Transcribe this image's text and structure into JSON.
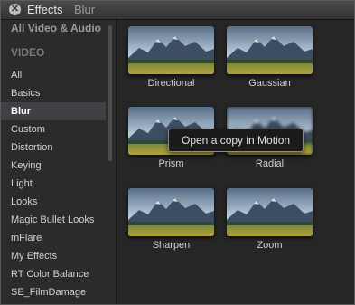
{
  "window": {
    "title": "Effects",
    "subtitle": "Blur"
  },
  "sidebar": {
    "all_label": "All Video & Audio",
    "section_header": "VIDEO",
    "items": [
      {
        "label": "All",
        "selected": false
      },
      {
        "label": "Basics",
        "selected": false
      },
      {
        "label": "Blur",
        "selected": true
      },
      {
        "label": "Custom",
        "selected": false
      },
      {
        "label": "Distortion",
        "selected": false
      },
      {
        "label": "Keying",
        "selected": false
      },
      {
        "label": "Light",
        "selected": false
      },
      {
        "label": "Looks",
        "selected": false
      },
      {
        "label": "Magic Bullet Looks",
        "selected": false
      },
      {
        "label": "mFlare",
        "selected": false
      },
      {
        "label": "My Effects",
        "selected": false
      },
      {
        "label": "RT Color Balance",
        "selected": false
      },
      {
        "label": "SE_FilmDamage",
        "selected": false
      }
    ]
  },
  "effects": [
    {
      "label": "Directional",
      "blur": 0
    },
    {
      "label": "Gaussian",
      "blur": 0
    },
    {
      "label": "Prism",
      "blur": 0
    },
    {
      "label": "Radial",
      "blur": 1.6
    },
    {
      "label": "Sharpen",
      "blur": 0
    },
    {
      "label": "Zoom",
      "blur": 0
    }
  ],
  "tooltip": {
    "text": "Open a copy in Motion"
  }
}
